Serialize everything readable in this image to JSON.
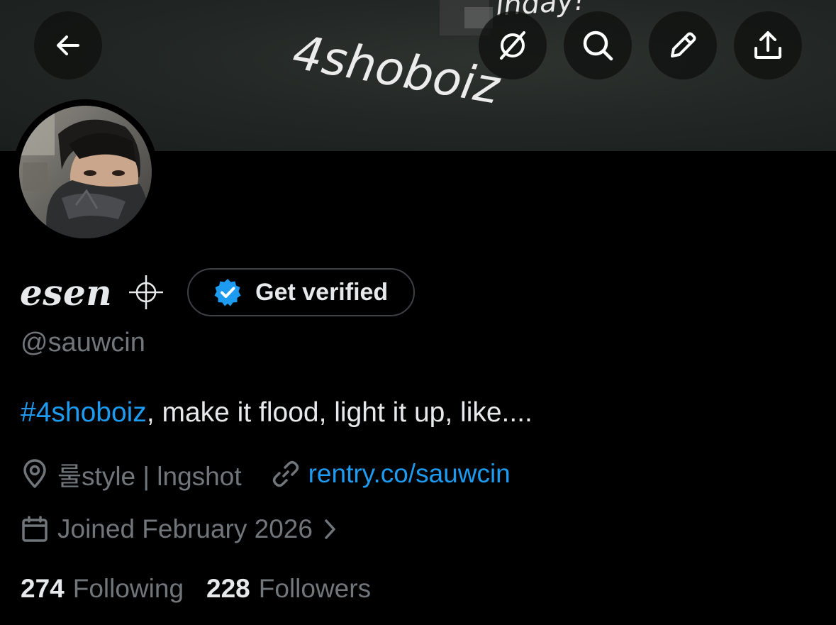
{
  "banner": {
    "art_text": "4shoboiz",
    "art_text_top": "inday!"
  },
  "toolbar": {
    "back_icon": "arrow-left-icon",
    "grok_icon": "grok-icon",
    "search_icon": "search-icon",
    "edit_icon": "pencil-icon",
    "share_icon": "share-icon"
  },
  "profile": {
    "display_name": "esen",
    "name_symbol": "crosshair-icon",
    "verify_label": "Get verified",
    "handle": "@sauwcin",
    "bio_hashtag": "#4shoboiz",
    "bio_text": ", make it flood, light it up, like....",
    "location": "룰style | lngshot",
    "website": "rentry.co/sauwcin",
    "joined": "Joined February 2026",
    "following_count": "274",
    "following_label": "Following",
    "followers_count": "228",
    "followers_label": "Followers"
  },
  "colors": {
    "background": "#000000",
    "text_primary": "#e7e9ea",
    "text_secondary": "#71767b",
    "link_blue": "#1d9bf0",
    "badge_blue": "#1d9bf0"
  }
}
